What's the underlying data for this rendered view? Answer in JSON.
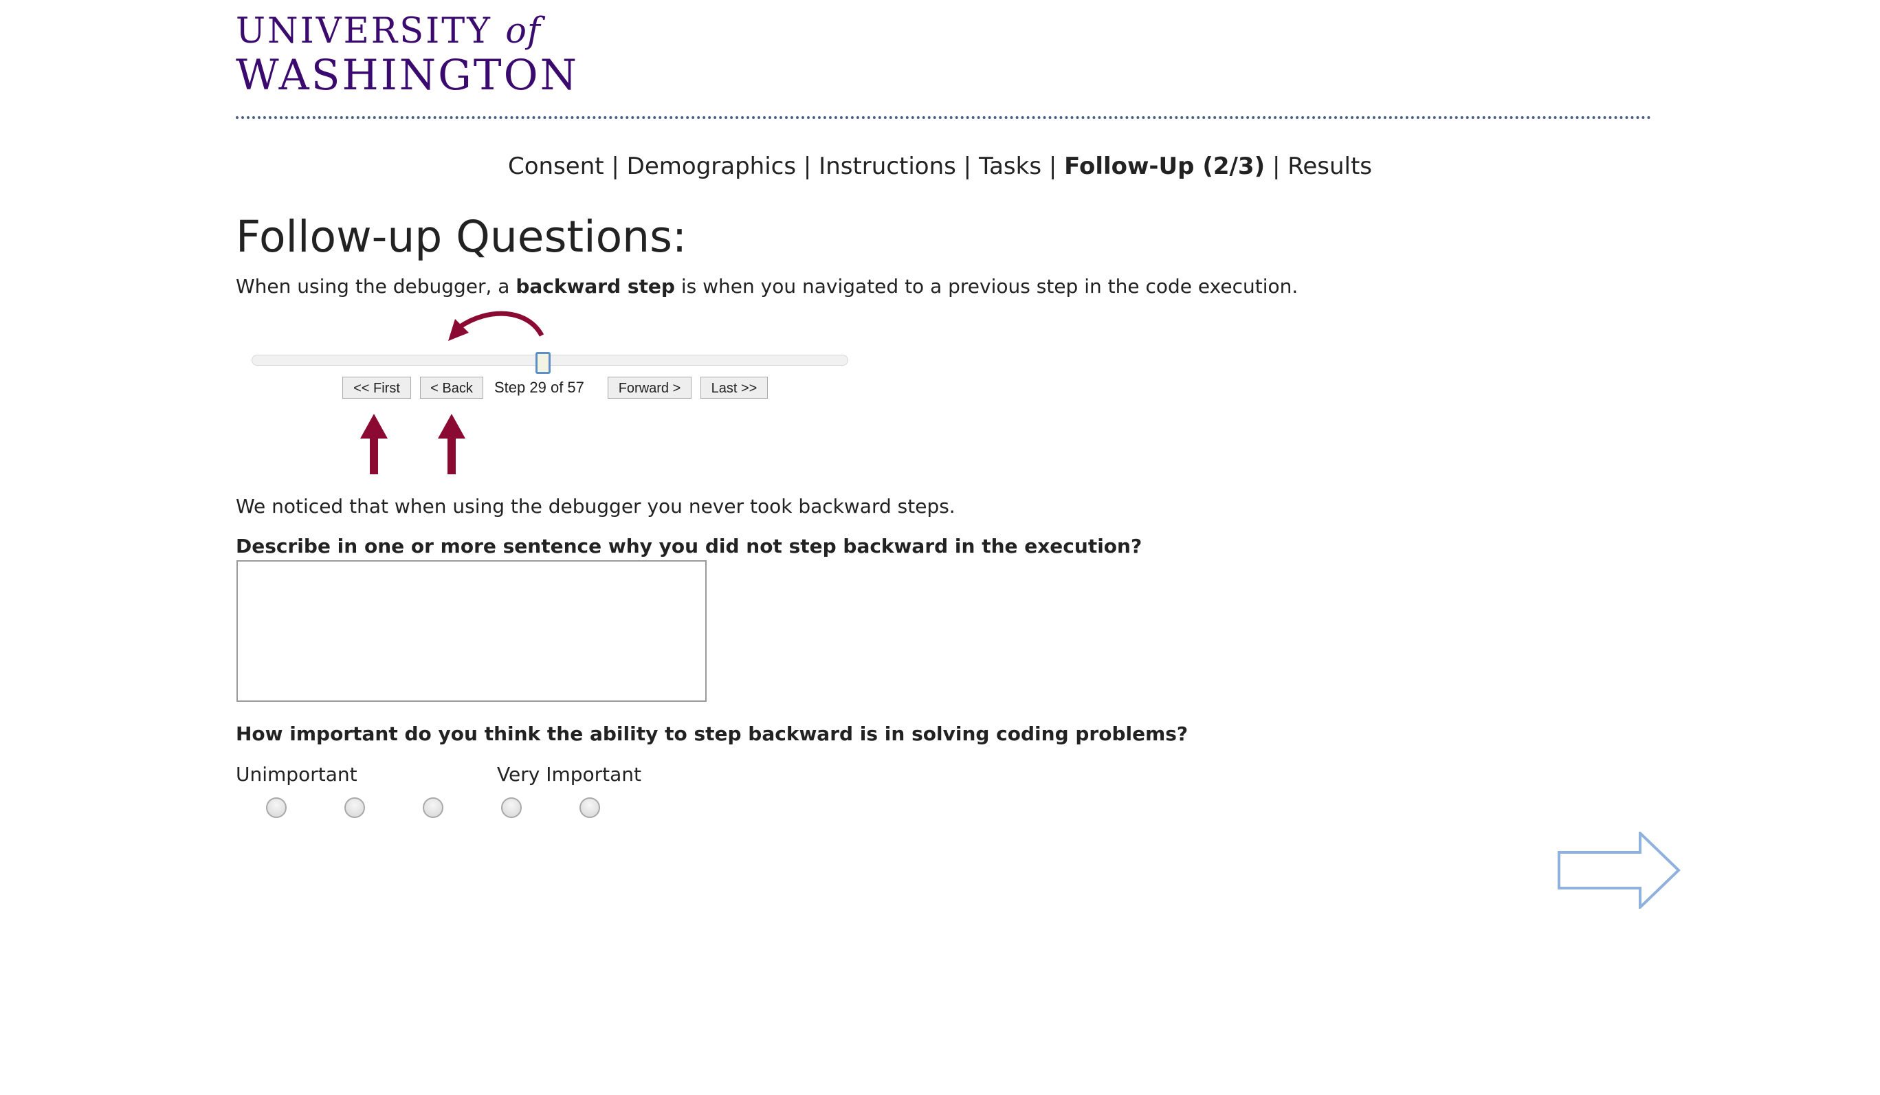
{
  "logo": {
    "university": "UNIVERSITY",
    "of": "of",
    "name": "WASHINGTON"
  },
  "nav": {
    "items": [
      "Consent",
      "Demographics",
      "Instructions",
      "Tasks",
      "Follow-Up (2/3)",
      "Results"
    ],
    "current_index": 4,
    "separator": "|"
  },
  "page": {
    "title": "Follow-up Questions:",
    "intro_before": "When using the debugger, a ",
    "intro_bold": "backward step",
    "intro_after": " is when you navigated to a previous step in the code execution."
  },
  "debugger": {
    "first_label": "<< First",
    "back_label": "< Back",
    "step_text": "Step 29 of 57",
    "forward_label": "Forward >",
    "last_label": "Last >>",
    "current_step": 29,
    "total_steps": 57
  },
  "noticed_text": "We noticed that when using the debugger you never took backward steps.",
  "question1": {
    "label": "Describe in one or more sentence why you did not step backward in the execution?",
    "value": ""
  },
  "question2": {
    "label": "How important do you think the ability to step backward is in solving coding problems?",
    "low_label": "Unimportant",
    "high_label": "Very Important",
    "options": [
      "1",
      "2",
      "3",
      "4",
      "5"
    ],
    "selected": null
  },
  "colors": {
    "brand_purple": "#3b0a6e",
    "annotation_arrow": "#8b0a33",
    "next_arrow": "#8fb1dd"
  },
  "icons": {
    "next": "right-arrow-icon"
  }
}
